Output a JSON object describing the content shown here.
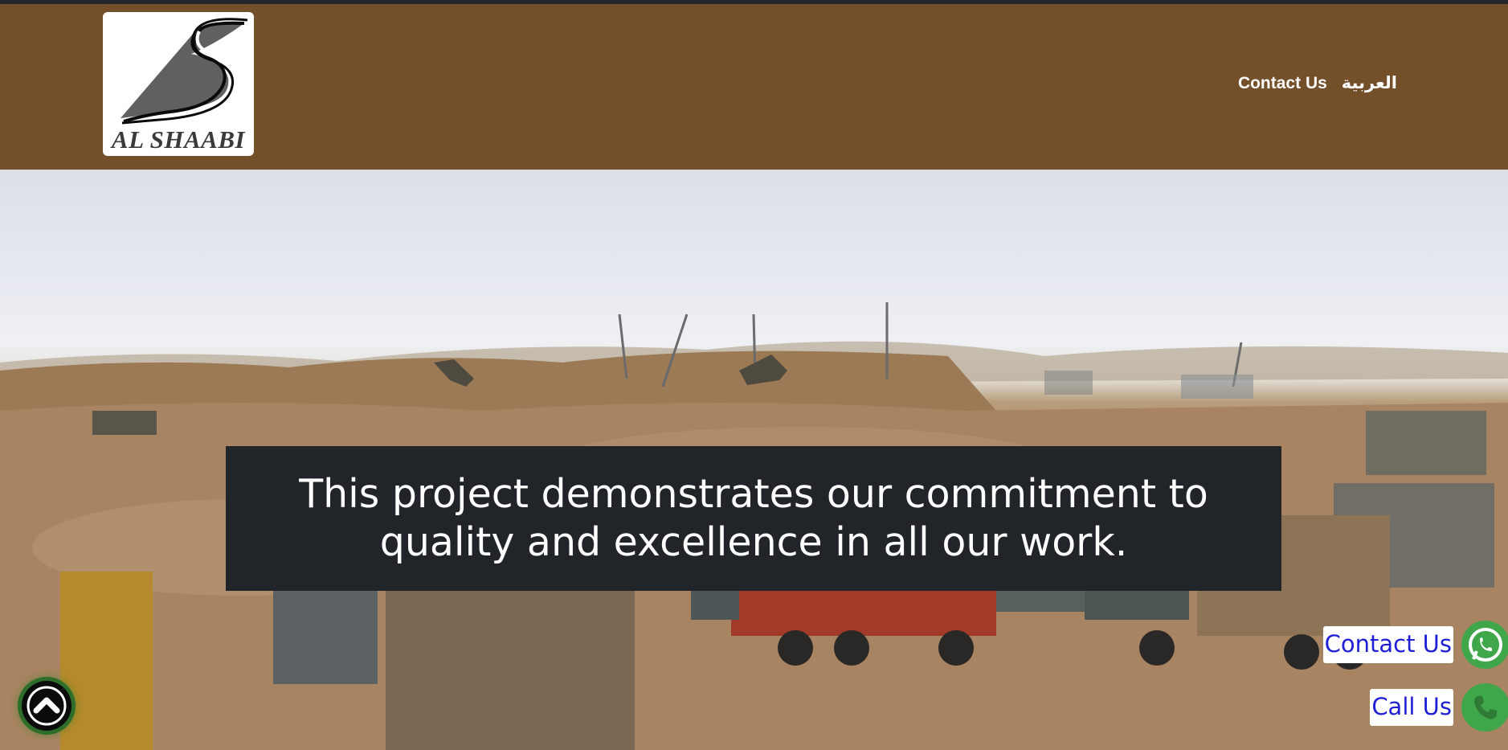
{
  "brand": {
    "logo_text": "AL SHAABI",
    "logo_icon": "s-swoosh-logo-icon",
    "header_color": "#734f2a",
    "topstrip_color": "#23272b"
  },
  "nav": {
    "items": [
      {
        "label": "العربية"
      },
      {
        "label": "Contact Us"
      }
    ]
  },
  "hero": {
    "caption": "This project demonstrates our commitment to quality and excellence in all our work.",
    "caption_bg": "#212529"
  },
  "floating": {
    "contact_label": "Contact Us",
    "contact_icon": "whatsapp-icon",
    "call_label": "Call Us",
    "call_icon": "phone-icon",
    "button_color": "#3fa64a",
    "label_color": "#1f1fd6"
  },
  "scroll_top": {
    "icon": "chevron-up-icon"
  }
}
